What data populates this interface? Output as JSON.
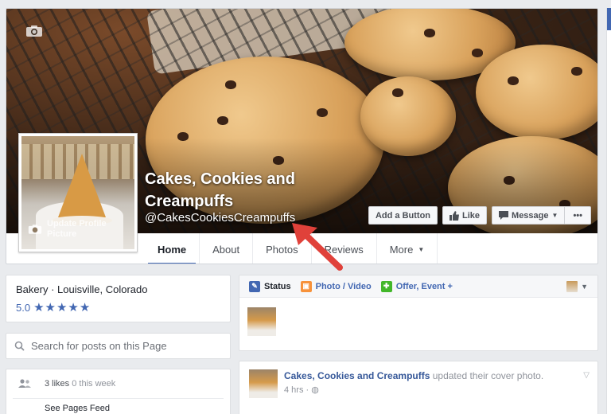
{
  "header": {
    "page_name": "Cakes, Cookies and Creampuffs",
    "handle": "@CakesCookiesCreampuffs",
    "profile_update_text": "Update Profile Picture",
    "buttons": {
      "add_button": "Add a Button",
      "like": "Like",
      "message": "Message",
      "more": "•••"
    },
    "tabs": [
      {
        "label": "Home",
        "active": true
      },
      {
        "label": "About"
      },
      {
        "label": "Photos"
      },
      {
        "label": "Reviews"
      },
      {
        "label": "More"
      }
    ]
  },
  "about": {
    "category_line": "Bakery · Louisville, Colorado",
    "rating_value": "5.0",
    "stars": "★★★★★"
  },
  "search": {
    "placeholder": "Search for posts on this Page"
  },
  "likes": {
    "count_text": "3 likes",
    "week_text": "0 this week",
    "feed_text": "See Pages Feed"
  },
  "composer": {
    "tabs": [
      {
        "label": "Status",
        "icon": "pencil-icon",
        "color": "#4267b2"
      },
      {
        "label": "Photo / Video",
        "icon": "photo-icon",
        "color": "#f7923b"
      },
      {
        "label": "Offer, Event +",
        "icon": "offer-icon",
        "color": "#42b72a"
      }
    ]
  },
  "post": {
    "author": "Cakes, Cookies and Creampuffs",
    "action": " updated their cover photo.",
    "time": "4 hrs · "
  },
  "colors": {
    "accent": "#4267b2",
    "link": "#365899",
    "arrow": "#e0413a"
  }
}
